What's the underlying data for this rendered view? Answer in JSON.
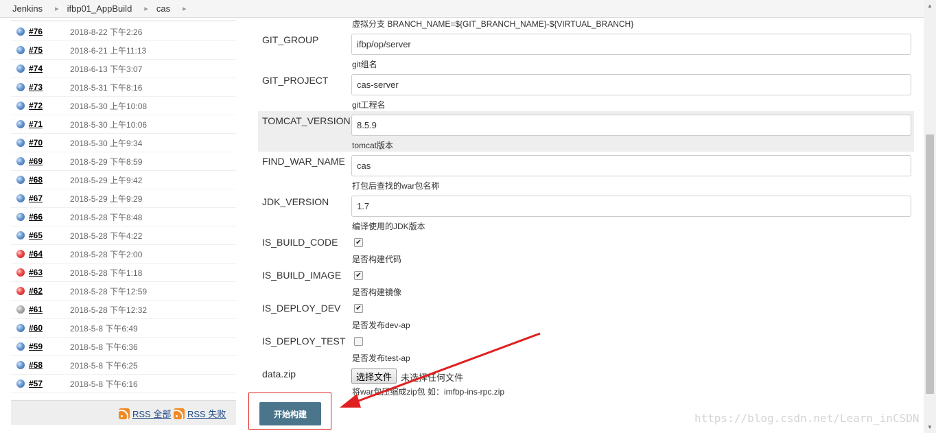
{
  "breadcrumb": [
    "Jenkins",
    "ifbp01_AppBuild",
    "cas"
  ],
  "build_history": [
    {
      "number": "#76",
      "date": "2018-8-22 下午2:26",
      "status": "blue"
    },
    {
      "number": "#75",
      "date": "2018-6-21 上午11:13",
      "status": "blue"
    },
    {
      "number": "#74",
      "date": "2018-6-13 下午3:07",
      "status": "blue"
    },
    {
      "number": "#73",
      "date": "2018-5-31 下午8:16",
      "status": "blue"
    },
    {
      "number": "#72",
      "date": "2018-5-30 上午10:08",
      "status": "blue"
    },
    {
      "number": "#71",
      "date": "2018-5-30 上午10:06",
      "status": "blue"
    },
    {
      "number": "#70",
      "date": "2018-5-30 上午9:34",
      "status": "blue"
    },
    {
      "number": "#69",
      "date": "2018-5-29 下午8:59",
      "status": "blue"
    },
    {
      "number": "#68",
      "date": "2018-5-29 上午9:42",
      "status": "blue"
    },
    {
      "number": "#67",
      "date": "2018-5-29 上午9:29",
      "status": "blue"
    },
    {
      "number": "#66",
      "date": "2018-5-28 下午8:48",
      "status": "blue"
    },
    {
      "number": "#65",
      "date": "2018-5-28 下午4:22",
      "status": "blue"
    },
    {
      "number": "#64",
      "date": "2018-5-28 下午2:00",
      "status": "red"
    },
    {
      "number": "#63",
      "date": "2018-5-28 下午1:18",
      "status": "red"
    },
    {
      "number": "#62",
      "date": "2018-5-28 下午12:59",
      "status": "red"
    },
    {
      "number": "#61",
      "date": "2018-5-28 下午12:32",
      "status": "grey"
    },
    {
      "number": "#60",
      "date": "2018-5-8 下午6:49",
      "status": "blue"
    },
    {
      "number": "#59",
      "date": "2018-5-8 下午6:36",
      "status": "blue"
    },
    {
      "number": "#58",
      "date": "2018-5-8 下午6:25",
      "status": "blue"
    },
    {
      "number": "#57",
      "date": "2018-5-8 下午6:16",
      "status": "blue"
    }
  ],
  "rss": {
    "all": "RSS 全部",
    "failures": "RSS 失败"
  },
  "top_description": "虚拟分支 BRANCH_NAME=${GIT_BRANCH_NAME}-${VIRTUAL_BRANCH}",
  "params": {
    "git_group": {
      "name": "GIT_GROUP",
      "value": "ifbp/op/server",
      "description": "git组名"
    },
    "git_project": {
      "name": "GIT_PROJECT",
      "value": "cas-server",
      "description": "git工程名"
    },
    "tomcat_version": {
      "name": "TOMCAT_VERSION",
      "value": "8.5.9",
      "description": "tomcat版本"
    },
    "find_war_name": {
      "name": "FIND_WAR_NAME",
      "value": "cas",
      "description": "打包后查找的war包名称"
    },
    "jdk_version": {
      "name": "JDK_VERSION",
      "value": "1.7",
      "description": "编译使用的JDK版本"
    },
    "is_build_code": {
      "name": "IS_BUILD_CODE",
      "checked": true,
      "description": "是否构建代码"
    },
    "is_build_image": {
      "name": "IS_BUILD_IMAGE",
      "checked": true,
      "description": "是否构建镜像"
    },
    "is_deploy_dev": {
      "name": "IS_DEPLOY_DEV",
      "checked": true,
      "description": "是否发布dev-ap"
    },
    "is_deploy_test": {
      "name": "IS_DEPLOY_TEST",
      "checked": false,
      "description": "是否发布test-ap"
    },
    "data_zip": {
      "name": "data.zip",
      "button": "选择文件",
      "status": "未选择任何文件",
      "description": "将war包压缩成zip包 如：imfbp-ins-rpc.zip"
    }
  },
  "build_button": "开始构建",
  "watermark": "https://blog.csdn.net/Learn_inCSDN",
  "colors": {
    "highlight": "#eeeeee",
    "build_button": "#4b758b",
    "arrow": "#e02020"
  }
}
